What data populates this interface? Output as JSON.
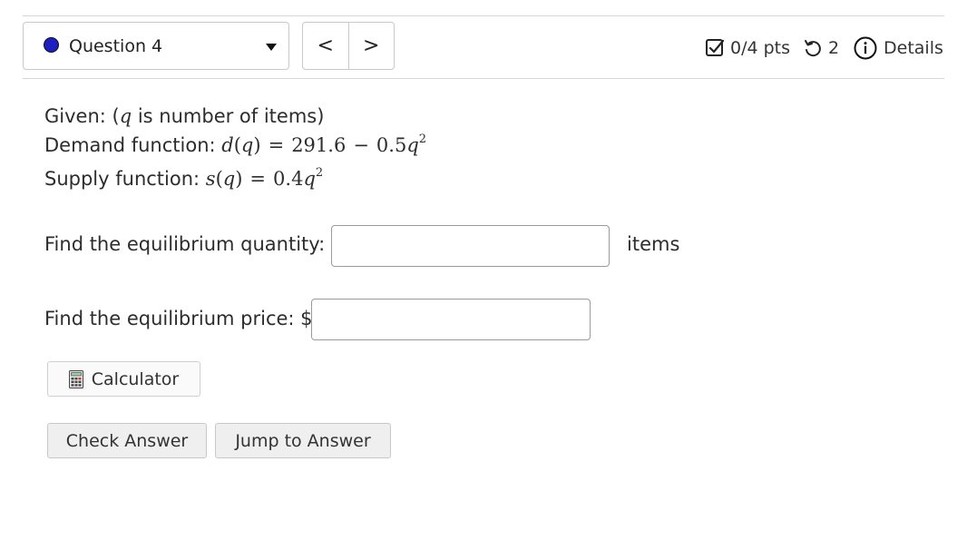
{
  "header": {
    "question_label": "Question 4",
    "prev_symbol": "<",
    "next_symbol": ">",
    "points": "0/4 pts",
    "attempts": "2",
    "details": "Details"
  },
  "question": {
    "given_prefix": "Given: (",
    "given_var": "q",
    "given_suffix": " is number of items)",
    "demand_label": "Demand function: ",
    "demand_lhs_fn": "d",
    "demand_lhs_arg": "q",
    "demand_rhs_a": "291.6",
    "demand_minus": "−",
    "demand_rhs_b": "0.5",
    "demand_var": "q",
    "demand_exp": "2",
    "supply_label": "Supply function: ",
    "supply_lhs_fn": "s",
    "supply_lhs_arg": "q",
    "supply_rhs_coef": "0.4",
    "supply_var": "q",
    "supply_exp": "2",
    "equals": "="
  },
  "answers": {
    "quantity_label": "Find the equilibrium quantity:",
    "quantity_value": "",
    "quantity_unit": "items",
    "price_label": "Find the equilibrium price: $",
    "price_value": ""
  },
  "buttons": {
    "calculator": "Calculator",
    "check": "Check Answer",
    "jump": "Jump to Answer"
  },
  "colors": {
    "question_dot": "#1d1fc1"
  }
}
